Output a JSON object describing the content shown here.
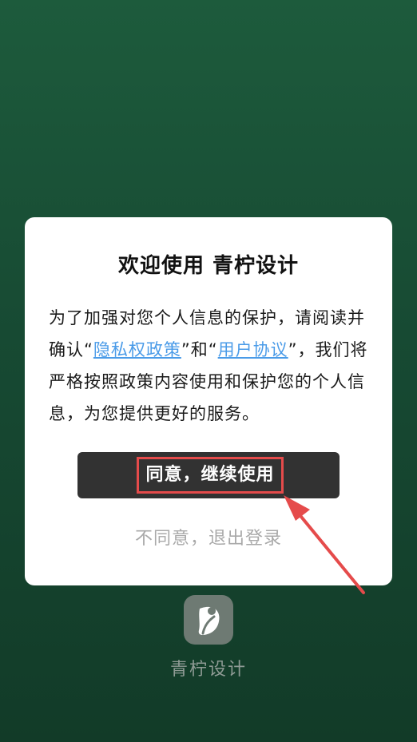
{
  "dialog": {
    "title": "欢迎使用 青柠设计",
    "body_part1": "为了加强对您个人信息的保护，请阅读并确认“",
    "privacy_link": "隐私权政策",
    "body_part2": "”和“",
    "terms_link": "用户协议",
    "body_part3": "”，我们将严格按照政策内容使用和保护您的个人信息，为您提供更好的服务。",
    "agree_label": "同意，继续使用",
    "decline_label": "不同意，退出登录"
  },
  "app": {
    "name": "青柠设计",
    "logo_icon": "lime-leaf-icon"
  },
  "colors": {
    "background": "#1d5b3c",
    "primary_button": "#323232",
    "link": "#4a9be8",
    "annotation": "#e54b4b"
  }
}
